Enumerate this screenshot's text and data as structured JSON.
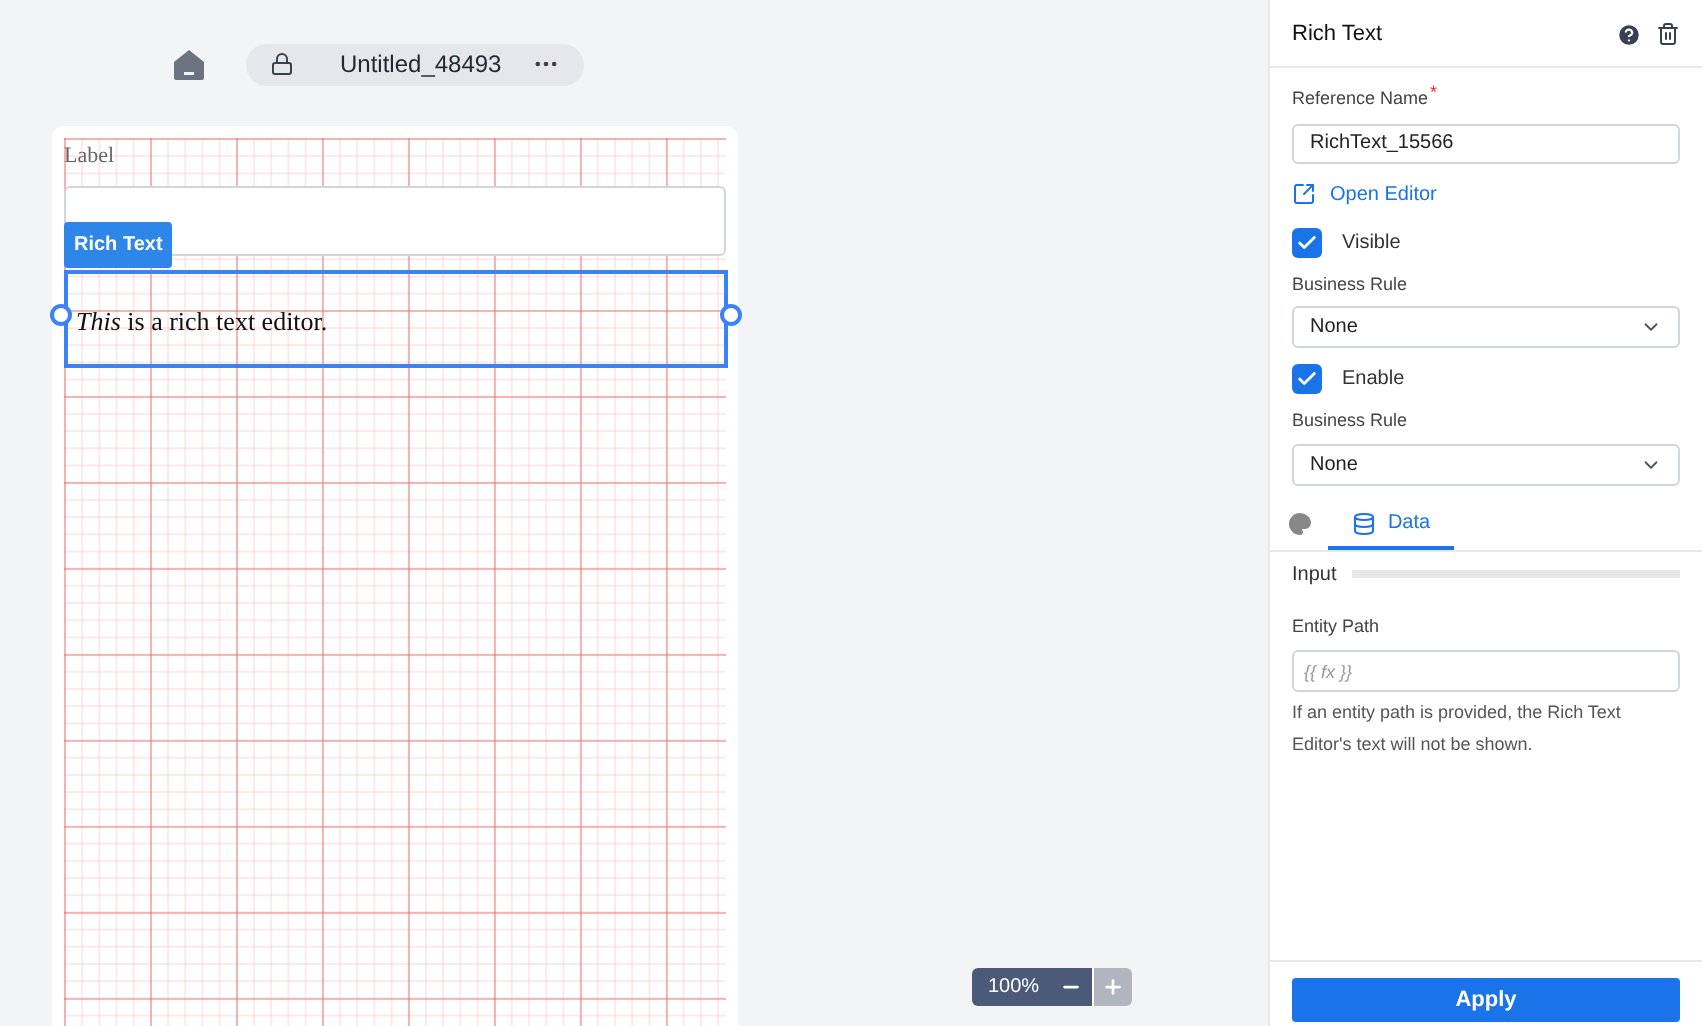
{
  "toolbar": {
    "title": "Untitled_48493"
  },
  "canvas": {
    "label": "Label",
    "component_tag": "Rich Text",
    "rich_text": "*This* is a rich text editor.",
    "selected": true
  },
  "zoom": {
    "value": "100%"
  },
  "panel": {
    "title": "Rich Text",
    "reference_name": {
      "label": "Reference Name",
      "required_mark": "*",
      "value": "RichText_15566"
    },
    "open_editor": "Open Editor",
    "visible": {
      "label": "Visible",
      "checked": true
    },
    "visible_rule": {
      "label": "Business Rule",
      "value": "None"
    },
    "enable": {
      "label": "Enable",
      "checked": true
    },
    "enable_rule": {
      "label": "Business Rule",
      "value": "None"
    },
    "tabs": [
      {
        "kind": "style",
        "selected": false
      },
      {
        "kind": "data",
        "label": "Data",
        "selected": true
      }
    ],
    "section": "Input",
    "entity_path": {
      "label": "Entity Path",
      "placeholder": "{{ fx }}",
      "help": "If an entity path is provided, the Rich Text Editor's text will not be shown."
    },
    "apply": "Apply"
  }
}
